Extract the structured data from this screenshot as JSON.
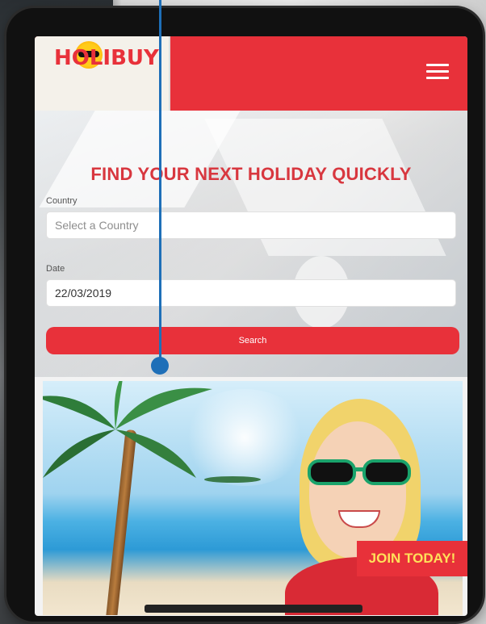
{
  "brand": {
    "logo_text": "HOLIBUY",
    "tagline_line1": "",
    "tagline_line2": ""
  },
  "hero": {
    "title": "FIND YOUR NEXT HOLIDAY QUICKLY"
  },
  "form": {
    "country_label": "Country",
    "country_placeholder": "Select a Country",
    "date_label": "Date",
    "date_value": "22/03/2019",
    "search_label": "Search"
  },
  "promo": {
    "cta": "JOIN TODAY!"
  },
  "icons": {
    "menu": "hamburger-icon",
    "logo_sun": "sun-icon"
  },
  "colors": {
    "brand_red": "#e8313a",
    "cta_text": "#ffe15a",
    "pointer_blue": "#1e6fb8"
  }
}
